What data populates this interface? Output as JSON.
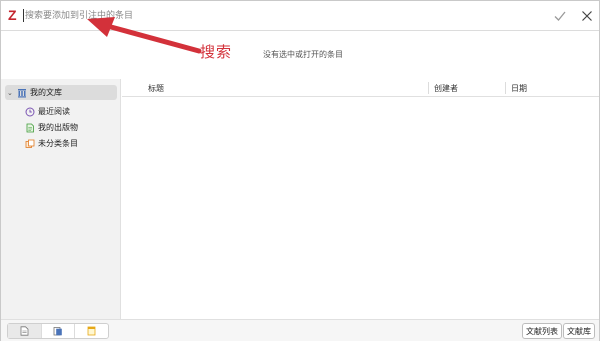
{
  "search": {
    "placeholder": "搜索要添加到引注中的条目"
  },
  "annotation": {
    "label": "搜索"
  },
  "info": {
    "empty_message": "没有选中或打开的条目"
  },
  "sidebar": {
    "root": {
      "label": "我的文库",
      "icon": "library-icon"
    },
    "items": [
      {
        "label": "最近阅读",
        "icon": "clock-icon"
      },
      {
        "label": "我的出版物",
        "icon": "document-icon"
      },
      {
        "label": "未分类条目",
        "icon": "unfiled-icon"
      }
    ]
  },
  "table": {
    "columns": [
      "标题",
      "创建者",
      "日期"
    ]
  },
  "footer": {
    "mode_buttons": [
      "list-mode-icon",
      "reader-mode-icon",
      "notes-mode-icon"
    ],
    "bibliography_button": "文献列表",
    "library_button": "文献库"
  },
  "colors": {
    "brand": "#c4262e",
    "annotation": "#d3313a"
  }
}
